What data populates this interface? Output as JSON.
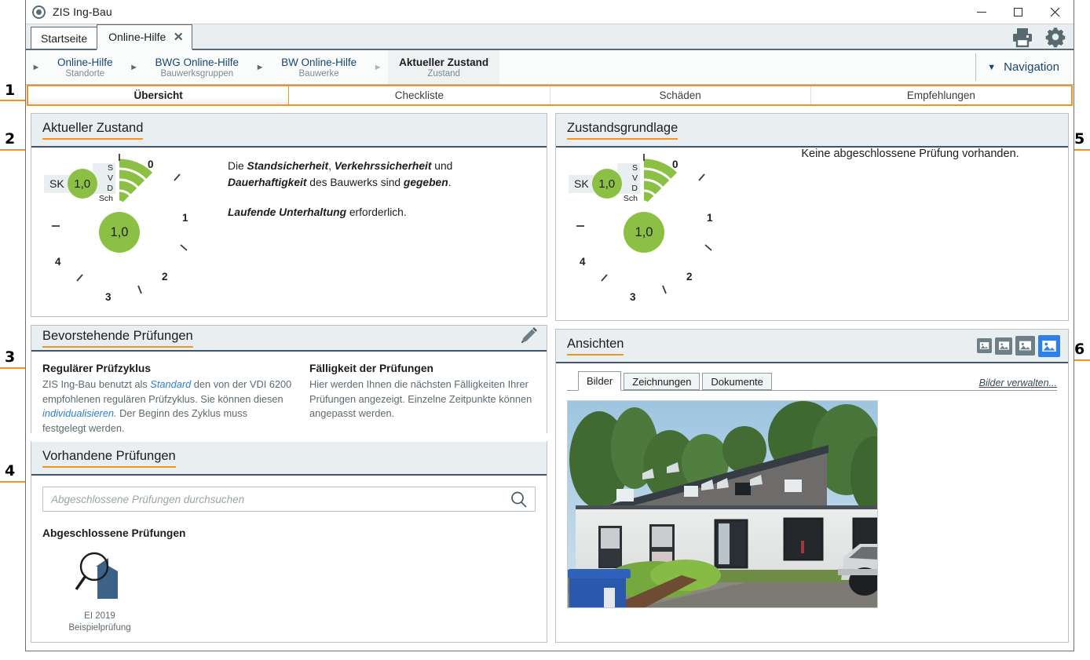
{
  "window": {
    "title": "ZIS Ing-Bau",
    "logo_icon": "app-circle-icon",
    "minimize": "–",
    "maximize": "□",
    "close": "✕"
  },
  "tabstrip": {
    "tabs": [
      {
        "label": "Startseite",
        "active": false,
        "closable": false
      },
      {
        "label": "Online-Hilfe",
        "active": true,
        "closable": true,
        "close_glyph": "✕"
      }
    ],
    "tools": [
      {
        "name": "print-icon",
        "label": "Drucken"
      },
      {
        "name": "gear-icon",
        "label": "Einstellungen"
      }
    ]
  },
  "breadcrumb": {
    "items": [
      {
        "main": "Online-Hilfe",
        "sub": "Standorte",
        "active": false
      },
      {
        "main": "BWG Online-Hilfe",
        "sub": "Bauwerksgruppen",
        "active": false
      },
      {
        "main": "BW Online-Hilfe",
        "sub": "Bauwerke",
        "active": false
      },
      {
        "main": "Aktueller Zustand",
        "sub": "Zustand",
        "active": true
      }
    ],
    "arrow_glyph": "►",
    "nav_button": {
      "label": "Navigation",
      "glyph": "▼"
    }
  },
  "main_tabs": [
    {
      "label": "Übersicht",
      "active": true
    },
    {
      "label": "Checkliste",
      "active": false
    },
    {
      "label": "Schäden",
      "active": false
    },
    {
      "label": "Empfehlungen",
      "active": false
    }
  ],
  "panels": {
    "aktueller_zustand": {
      "title": "Aktueller Zustand",
      "gauge": {
        "sk_label": "SK",
        "sk_value": "1,0",
        "main_value": "1,0",
        "arc_labels": [
          "S",
          "V",
          "D",
          "Sch"
        ],
        "arc_values": [
          1.0,
          1.0,
          1.0,
          1.0
        ],
        "scale": [
          "0",
          "1",
          "2",
          "3",
          "4"
        ],
        "minus_glyph": "–"
      },
      "text": {
        "line1_pre": "Die ",
        "b1": "Standsicherheit",
        "sep1": ", ",
        "b2": "Verkehrssicherheit",
        "sep2": " und ",
        "b3": "Dauerhaftigkeit",
        "line1_post": " des Bauwerks sind ",
        "b4": "gegeben",
        "line1_end": ".",
        "b5": "Laufende Unterhaltung",
        "line2_post": " erforderlich."
      }
    },
    "zustandsgrundlage": {
      "title": "Zustandsgrundlage",
      "gauge": {
        "sk_label": "SK",
        "sk_value": "1,0",
        "main_value": "1,0",
        "arc_labels": [
          "S",
          "V",
          "D",
          "Sch"
        ],
        "arc_values": [
          1.0,
          1.0,
          1.0,
          1.0
        ],
        "scale": [
          "0",
          "1",
          "2",
          "3",
          "4"
        ],
        "minus_glyph": "–"
      },
      "message": "Keine abgeschlossene Prüfung vorhanden."
    },
    "bevorstehende_pruefungen": {
      "title": "Bevorstehende Prüfungen",
      "edit_icon": "pencil-icon",
      "left": {
        "heading": "Regulärer Prüfzyklus",
        "t1": "ZIS Ing-Bau benutzt als ",
        "link1": "Standard",
        "t2": " den von der VDI 6200 empfohlenen regulären Prüfzyklus. Sie können diesen ",
        "link2": "individualisieren.",
        "t3": " Der Beginn des Zyklus muss  festgelegt werden."
      },
      "right": {
        "heading": "Fälligkeit der Prüfungen",
        "text": "Hier werden Ihnen die nächsten Fälligkeiten Ihrer Prüfungen angezeigt. Einzelne Zeitpunkte können angepasst werden."
      }
    },
    "vorhandene_pruefungen": {
      "title": "Vorhandene Prüfungen",
      "search_placeholder": "Abgeschlossene Prüfungen durchsuchen",
      "search_value": "",
      "search_icon": "search-icon",
      "subtitle": "Abgeschlossene Prüfungen",
      "items": [
        {
          "icon": "inspection-magnifier-building-icon",
          "line1": "EI 2019",
          "line2": "Beispielprüfung"
        }
      ]
    },
    "ansichten": {
      "title": "Ansichten",
      "size_icons": [
        {
          "name": "image-size-xsmall-icon",
          "selected": false
        },
        {
          "name": "image-size-small-icon",
          "selected": false
        },
        {
          "name": "image-size-medium-icon",
          "selected": false
        },
        {
          "name": "image-size-large-icon",
          "selected": true
        }
      ],
      "tabs": [
        {
          "label": "Bilder",
          "active": true
        },
        {
          "label": "Zeichnungen",
          "active": false
        },
        {
          "label": "Dokumente",
          "active": false
        }
      ],
      "manage_link": "Bilder verwalten...",
      "photo_alt": "building-photo"
    }
  },
  "annotations": [
    {
      "num": "1"
    },
    {
      "num": "2"
    },
    {
      "num": "3"
    },
    {
      "num": "4"
    },
    {
      "num": "5"
    },
    {
      "num": "6"
    }
  ],
  "colors": {
    "accent_orange": "#ef9421",
    "panel_border_blue": "#41556b",
    "green": "#8cc044",
    "link_blue": "#2a7fd4",
    "header_bg": "#e9eef0"
  }
}
